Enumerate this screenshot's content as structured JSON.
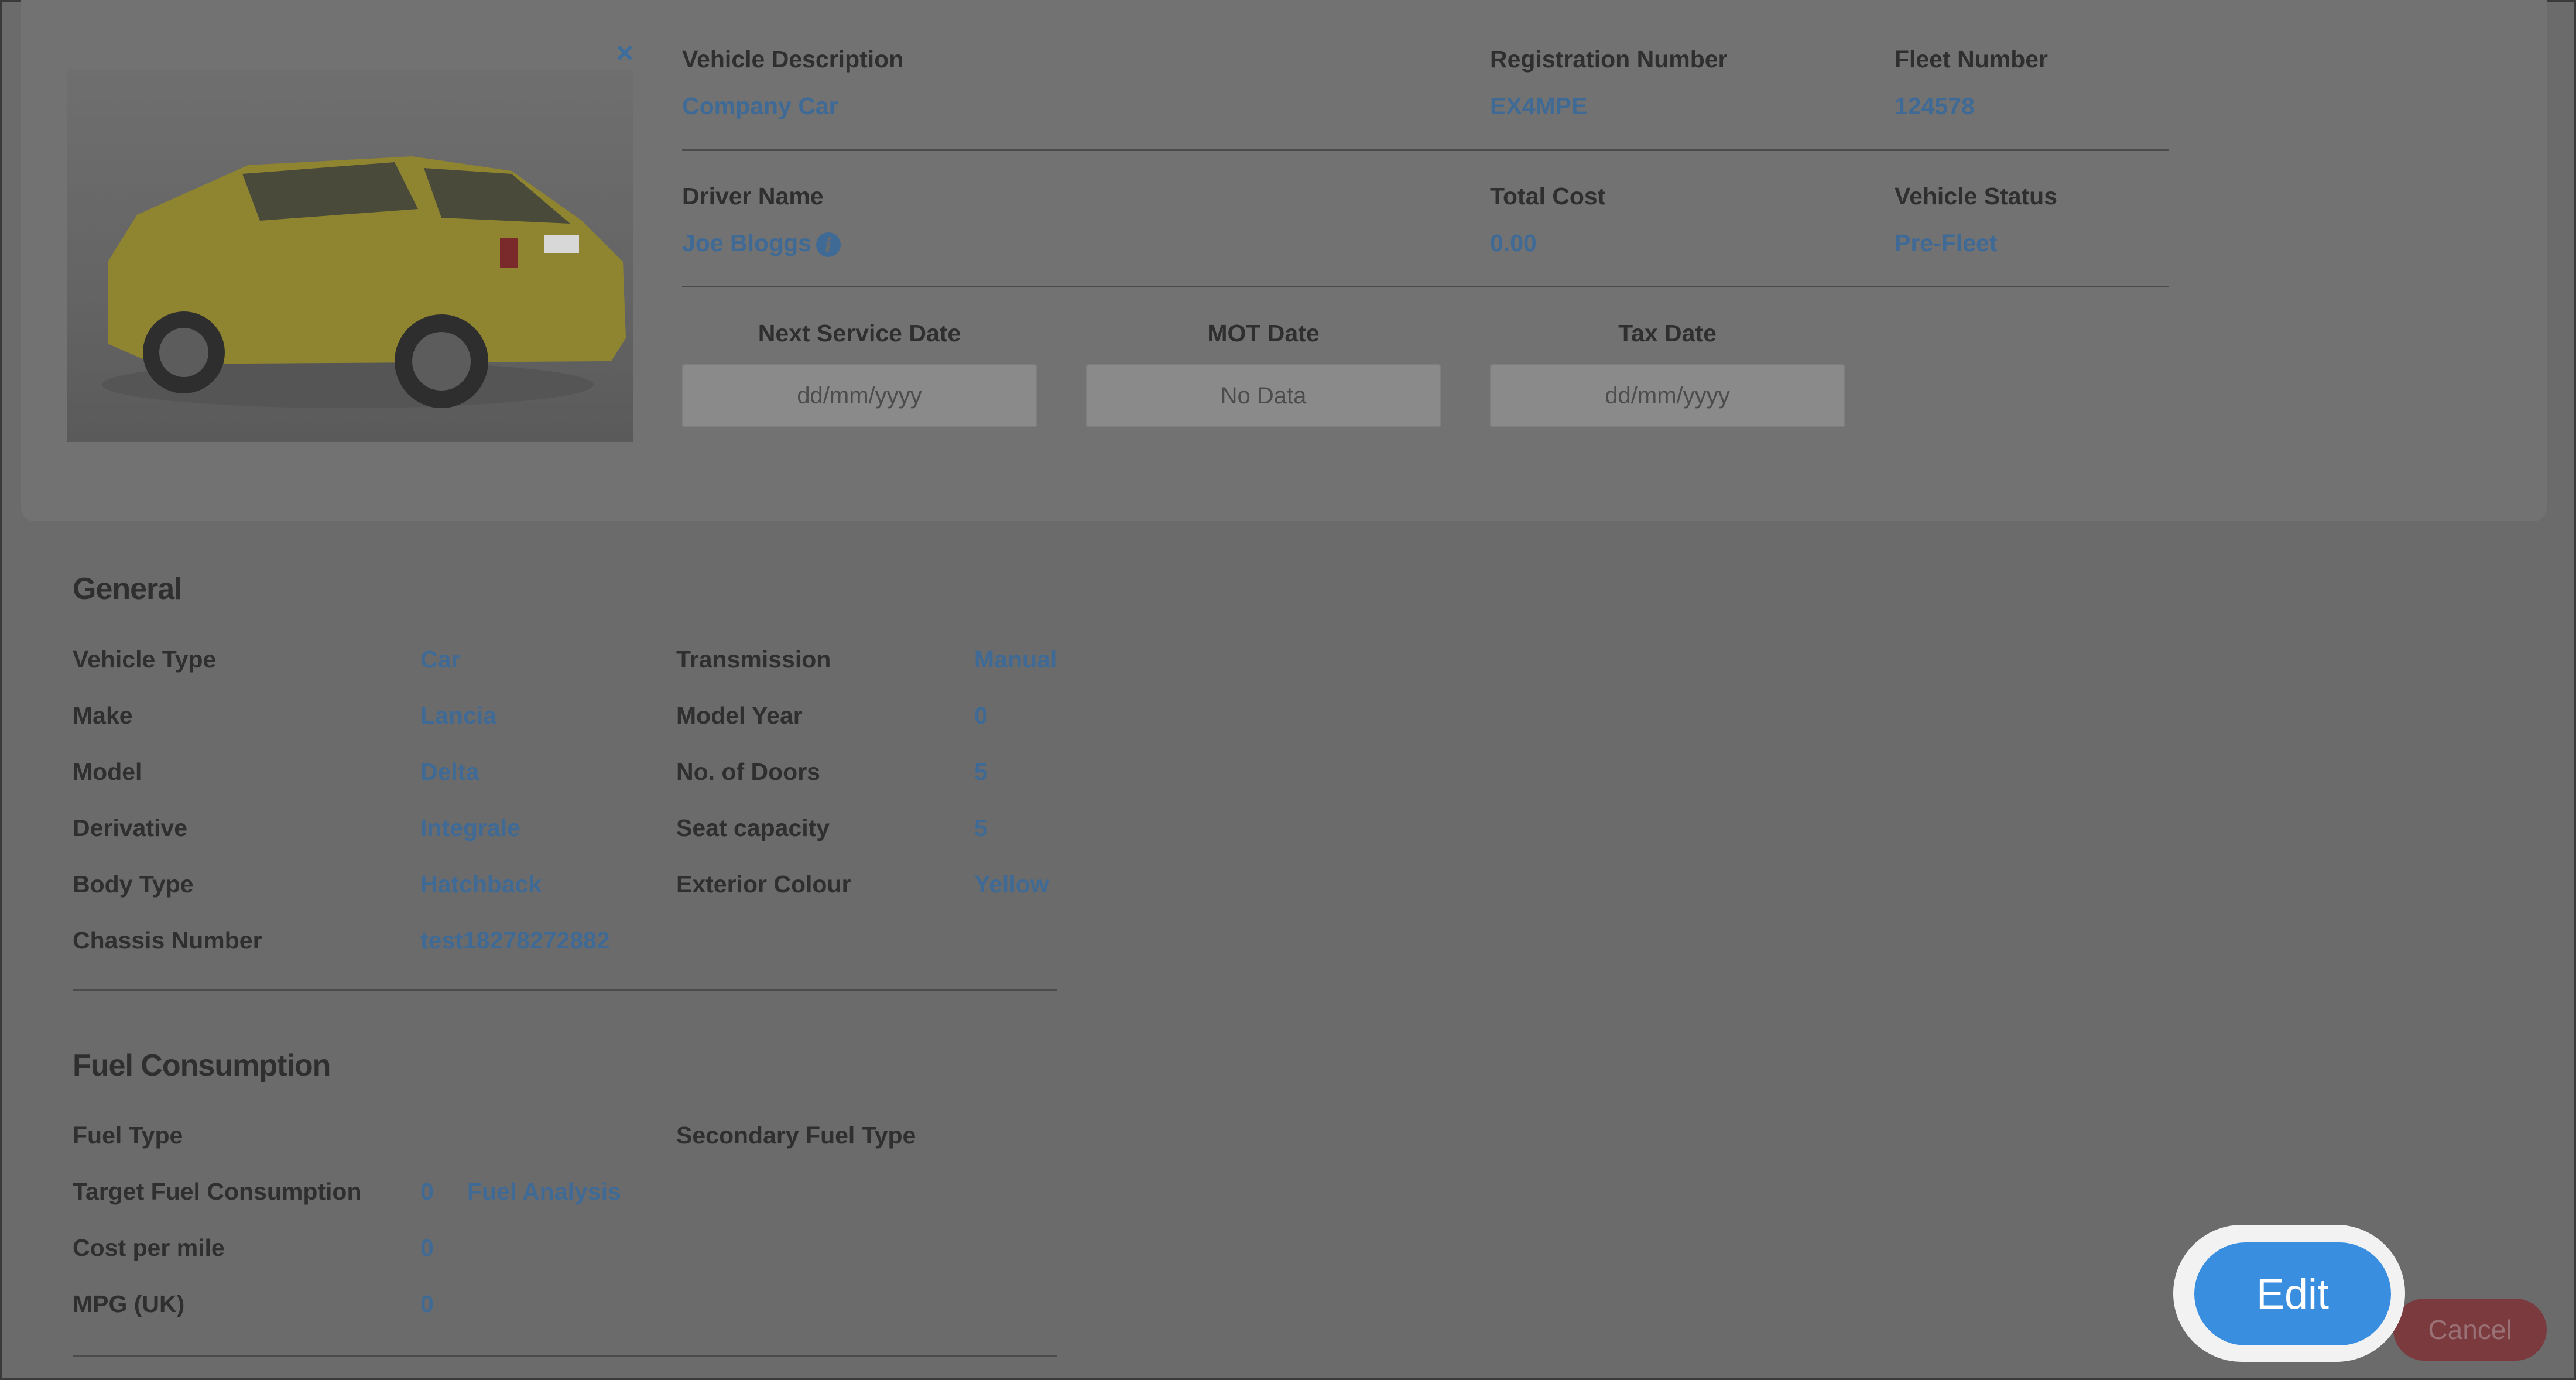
{
  "header": {
    "close_glyph": "×",
    "vehicle_description": {
      "label": "Vehicle Description",
      "value": "Company Car"
    },
    "registration_number": {
      "label": "Registration Number",
      "value": "EX4MPE"
    },
    "fleet_number": {
      "label": "Fleet Number",
      "value": "124578"
    },
    "driver_name": {
      "label": "Driver Name",
      "value": "Joe Bloggs",
      "info_glyph": "i"
    },
    "total_cost": {
      "label": "Total Cost",
      "value": "0.00"
    },
    "vehicle_status": {
      "label": "Vehicle Status",
      "value": "Pre-Fleet"
    },
    "next_service_date": {
      "label": "Next Service Date",
      "placeholder": "dd/mm/yyyy"
    },
    "mot_date": {
      "label": "MOT Date",
      "value": "No Data"
    },
    "tax_date": {
      "label": "Tax Date",
      "placeholder": "dd/mm/yyyy"
    }
  },
  "general": {
    "title": "General",
    "left": [
      {
        "label": "Vehicle Type",
        "value": "Car"
      },
      {
        "label": "Make",
        "value": "Lancia"
      },
      {
        "label": "Model",
        "value": "Delta"
      },
      {
        "label": "Derivative",
        "value": "Integrale"
      },
      {
        "label": "Body Type",
        "value": "Hatchback"
      },
      {
        "label": "Chassis Number",
        "value": "test18278272882"
      }
    ],
    "right": [
      {
        "label": "Transmission",
        "value": "Manual"
      },
      {
        "label": "Model Year",
        "value": "0"
      },
      {
        "label": "No. of Doors",
        "value": "5"
      },
      {
        "label": "Seat capacity",
        "value": "5"
      },
      {
        "label": "Exterior Colour",
        "value": "Yellow"
      }
    ]
  },
  "fuel": {
    "title": "Fuel Consumption",
    "fuel_type": {
      "label": "Fuel Type"
    },
    "secondary_fuel_type": {
      "label": "Secondary Fuel Type"
    },
    "target": {
      "label": "Target Fuel Consumption",
      "value": "0",
      "link": "Fuel Analysis"
    },
    "cost_per_mile": {
      "label": "Cost per mile",
      "value": "0"
    },
    "mpg": {
      "label": "MPG (UK)",
      "value": "0"
    }
  },
  "actions": {
    "edit_label": "Edit",
    "cancel_label": "Cancel"
  },
  "colors": {
    "overlay": "#6b6b6b",
    "accent": "#3a8ee0",
    "value_text": "#3f6a96",
    "cancel": "#7a3a3e"
  }
}
